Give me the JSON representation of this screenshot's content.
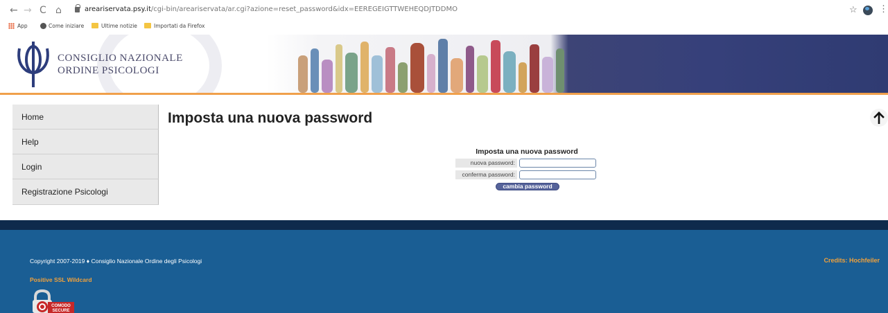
{
  "browser": {
    "url_host": "areariservata.psy.it",
    "url_path": "/cgi-bin/areariservata/ar.cgi?azione=reset_password&idx=EEREGEIGTTWEHEQDJTDDMO",
    "bookmarks": {
      "apps": "App",
      "get_started": "Come iniziare",
      "latest_news": "Ultime notizie",
      "imported": "Importati da Firefox"
    }
  },
  "header": {
    "org_line1": "CONSIGLIO NAZIONALE",
    "org_line2": "ORDINE PSICOLOGI"
  },
  "sidebar": {
    "items": [
      {
        "label": "Home"
      },
      {
        "label": "Help"
      },
      {
        "label": "Login"
      },
      {
        "label": "Registrazione Psicologi"
      }
    ]
  },
  "main": {
    "title": "Imposta una nuova password",
    "form": {
      "title": "Imposta una nuova password",
      "new_password_label": "nuova password:",
      "new_password_value": "",
      "confirm_password_label": "conferma password:",
      "confirm_password_value": "",
      "submit_label": "cambia password"
    }
  },
  "footer": {
    "copyright": "Copyright 2007-2019  ♦  Consiglio Nazionale Ordine degli Psicologi",
    "credits": "Credits: Hochfeiler",
    "ssl": "Positive SSL Wildcard",
    "badge_text_1": "COMODO",
    "badge_text_2": "SECURE"
  },
  "colors": {
    "accent_orange": "#f0a13c",
    "footer_blue": "#1a5e94",
    "footer_dark": "#0e2a4c",
    "button_blue": "#56639a"
  }
}
